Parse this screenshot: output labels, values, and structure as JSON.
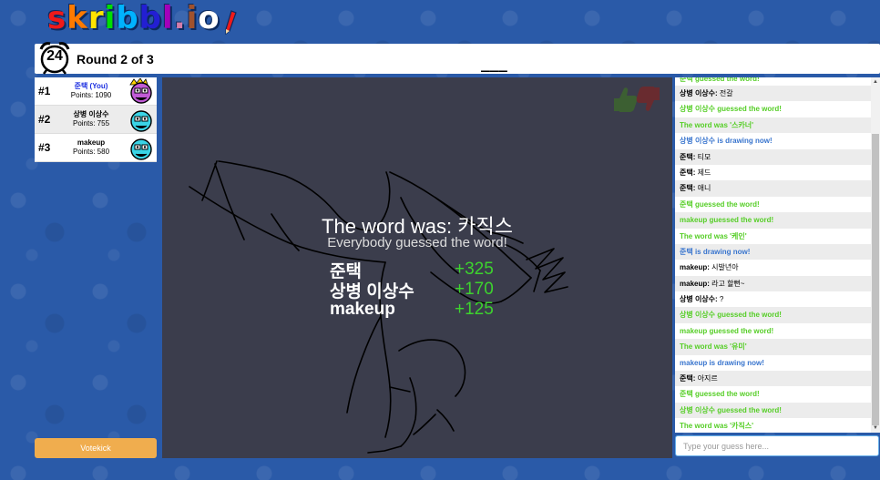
{
  "logo": {
    "letters": [
      {
        "ch": "s",
        "color": "#ef1a1a"
      },
      {
        "ch": "k",
        "color": "#ff7a00"
      },
      {
        "ch": "r",
        "color": "#ffe400"
      },
      {
        "ch": "i",
        "color": "#00e000"
      },
      {
        "ch": "b",
        "color": "#00b2ff"
      },
      {
        "ch": "b",
        "color": "#231fd3"
      },
      {
        "ch": "l",
        "color": "#a300ba"
      },
      {
        "ch": ".",
        "color": "#d37caa"
      },
      {
        "ch": "i",
        "color": "#a0522d"
      },
      {
        "ch": "o",
        "color": "#ffffff"
      }
    ]
  },
  "header": {
    "timer": "24",
    "round": "Round 2 of 3",
    "hint": "___"
  },
  "players": [
    {
      "rank": "#1",
      "name": "준택 (You)",
      "points": "Points: 1090",
      "you": true,
      "color": "#c15bd6",
      "crown": true
    },
    {
      "rank": "#2",
      "name": "상병 이상수",
      "points": "Points: 755",
      "you": false,
      "color": "#3ad4e6",
      "crown": false
    },
    {
      "rank": "#3",
      "name": "makeup",
      "points": "Points: 580",
      "you": false,
      "color": "#3ad4e6",
      "crown": false
    }
  ],
  "votekick_label": "Votekick",
  "overlay": {
    "word_was": "The word was: 카직스",
    "everybody": "Everybody guessed the word!",
    "scores": [
      {
        "name": "준택",
        "value": "+325"
      },
      {
        "name": "상병 이상수",
        "value": "+170"
      },
      {
        "name": "makeup",
        "value": "+125"
      }
    ]
  },
  "chat": {
    "messages": [
      {
        "type": "green",
        "text": "준택 guessed the word!"
      },
      {
        "type": "chat",
        "who": "상병 이상수:",
        "text": " 전갈"
      },
      {
        "type": "green",
        "text": "상병 이상수 guessed the word!"
      },
      {
        "type": "green",
        "text": "The word was '스카너'"
      },
      {
        "type": "blue",
        "text": "상병 이상수 is drawing now!"
      },
      {
        "type": "chat",
        "who": "준택:",
        "text": " 티모"
      },
      {
        "type": "chat",
        "who": "준택:",
        "text": " 제드"
      },
      {
        "type": "chat",
        "who": "준택:",
        "text": " 애니"
      },
      {
        "type": "green",
        "text": "준택 guessed the word!"
      },
      {
        "type": "green",
        "text": "makeup guessed the word!"
      },
      {
        "type": "green",
        "text": "The word was '케인'"
      },
      {
        "type": "blue",
        "text": "준택 is drawing now!"
      },
      {
        "type": "chat",
        "who": "makeup:",
        "text": " 시발년아"
      },
      {
        "type": "chat",
        "who": "makeup:",
        "text": " 라고 할뻔~"
      },
      {
        "type": "chat",
        "who": "상병 이상수:",
        "text": " ?"
      },
      {
        "type": "green",
        "text": "상병 이상수 guessed the word!"
      },
      {
        "type": "green",
        "text": "makeup guessed the word!"
      },
      {
        "type": "green",
        "text": "The word was '유미'"
      },
      {
        "type": "blue",
        "text": "makeup is drawing now!"
      },
      {
        "type": "chat",
        "who": "준택:",
        "text": " 아지르"
      },
      {
        "type": "green",
        "text": "준택 guessed the word!"
      },
      {
        "type": "green",
        "text": "상병 이상수 guessed the word!"
      },
      {
        "type": "green",
        "text": "The word was '카직스'"
      }
    ],
    "input_placeholder": "Type your guess here..."
  }
}
